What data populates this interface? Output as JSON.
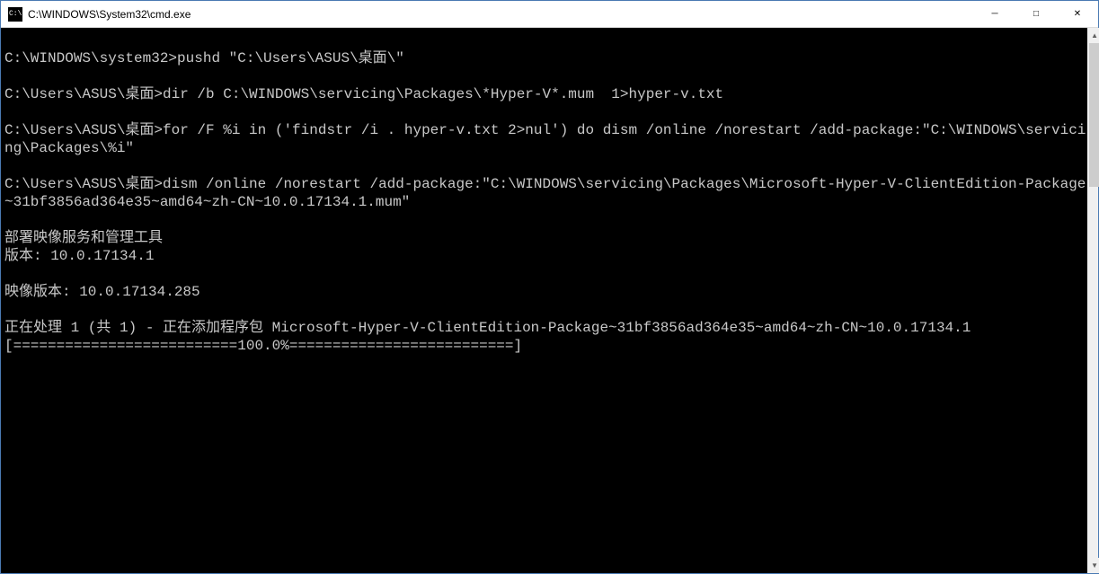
{
  "titlebar": {
    "title": "C:\\WINDOWS\\System32\\cmd.exe"
  },
  "terminal": {
    "lines": [
      "",
      "C:\\WINDOWS\\system32>pushd \"C:\\Users\\ASUS\\桌面\\\"",
      "",
      "C:\\Users\\ASUS\\桌面>dir /b C:\\WINDOWS\\servicing\\Packages\\*Hyper-V*.mum  1>hyper-v.txt",
      "",
      "C:\\Users\\ASUS\\桌面>for /F %i in ('findstr /i . hyper-v.txt 2>nul') do dism /online /norestart /add-package:\"C:\\WINDOWS\\servicing\\Packages\\%i\"",
      "",
      "C:\\Users\\ASUS\\桌面>dism /online /norestart /add-package:\"C:\\WINDOWS\\servicing\\Packages\\Microsoft-Hyper-V-ClientEdition-Package~31bf3856ad364e35~amd64~zh-CN~10.0.17134.1.mum\"",
      "",
      "部署映像服务和管理工具",
      "版本: 10.0.17134.1",
      "",
      "映像版本: 10.0.17134.285",
      "",
      "正在处理 1 (共 1) - 正在添加程序包 Microsoft-Hyper-V-ClientEdition-Package~31bf3856ad364e35~amd64~zh-CN~10.0.17134.1",
      "[==========================100.0%==========================]"
    ]
  },
  "winbuttons": {
    "min": "─",
    "max": "□",
    "close": "✕"
  },
  "scroll": {
    "up": "▲",
    "down": "▼"
  }
}
